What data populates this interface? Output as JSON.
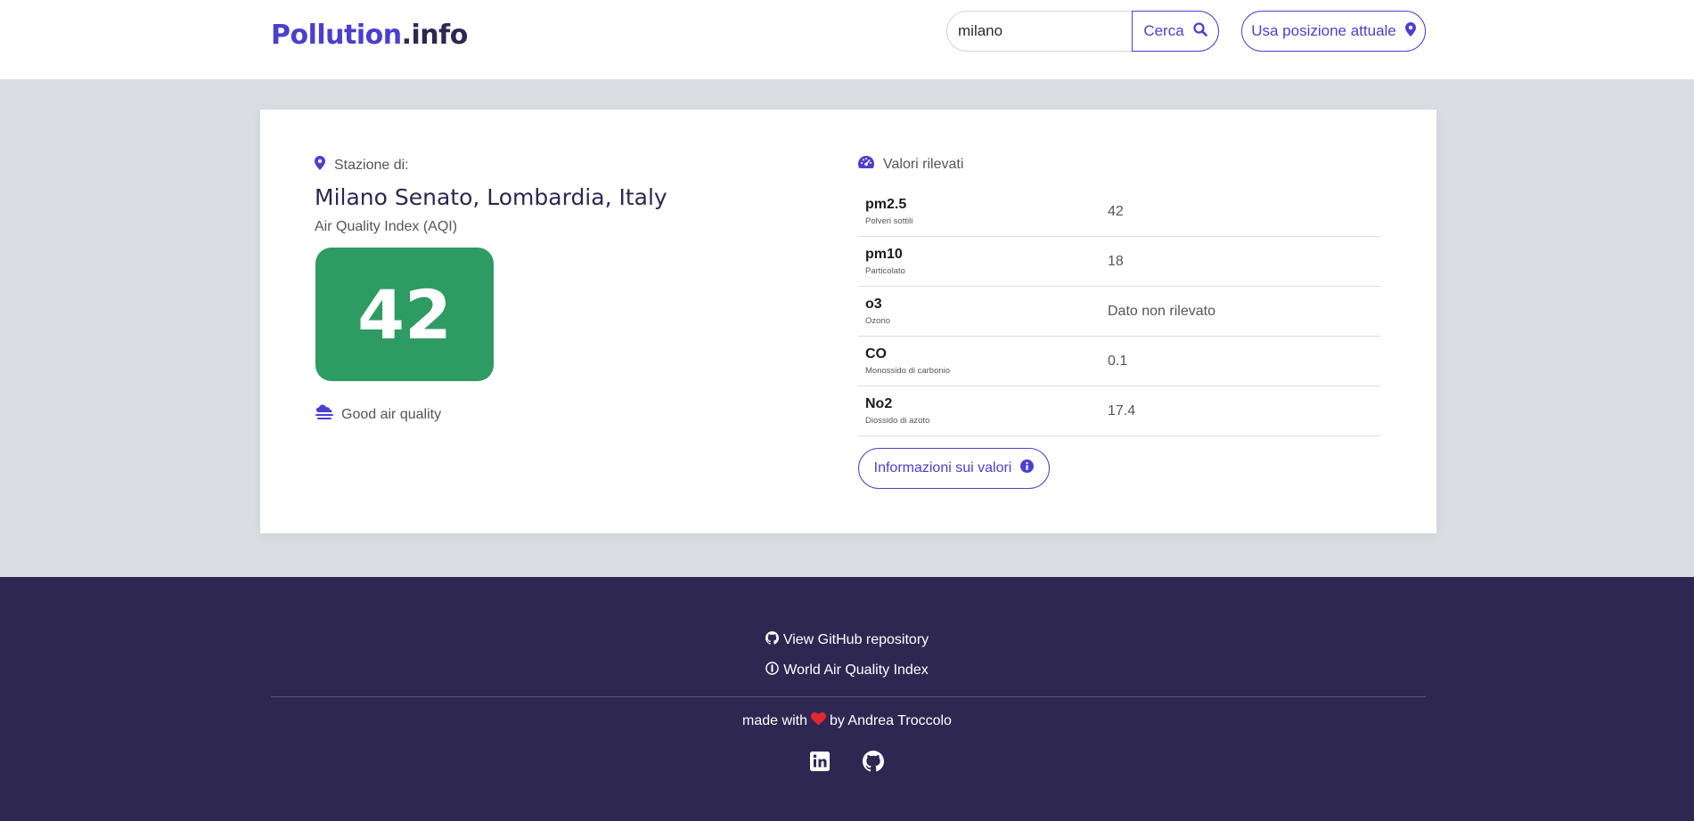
{
  "header": {
    "logo_brand": "Pollution",
    "logo_tld": ".info",
    "search": {
      "value": "milano",
      "button_label": "Cerca"
    },
    "location_button_label": "Usa posizione attuale"
  },
  "station": {
    "label": "Stazione di:",
    "city": "Milano Senato, Lombardia, Italy",
    "aqi_label": "Air Quality Index (AQI)",
    "aqi_value": "42",
    "aqi_color": "#2e9b62",
    "quality_text": "Good air quality"
  },
  "values": {
    "label": "Valori rilevati",
    "rows": [
      {
        "name": "pm2.5",
        "desc": "Polveri sottili",
        "value": "42"
      },
      {
        "name": "pm10",
        "desc": "Particolato",
        "value": "18"
      },
      {
        "name": "o3",
        "desc": "Ozono",
        "value": "Dato non rilevato"
      },
      {
        "name": "CO",
        "desc": "Monossido di carbonio",
        "value": "0.1"
      },
      {
        "name": "No2",
        "desc": "Diossido di azoto",
        "value": "17.4"
      }
    ],
    "info_button_label": "Informazioni sui valori"
  },
  "footer": {
    "github_link": "View GitHub repository",
    "waqi_link": "World Air Quality Index",
    "made_with": "made with",
    "by_author": "by Andrea Troccolo"
  },
  "colors": {
    "accent": "#4b3fcf",
    "footer_bg": "#2e2752",
    "heart": "#e3262f"
  }
}
